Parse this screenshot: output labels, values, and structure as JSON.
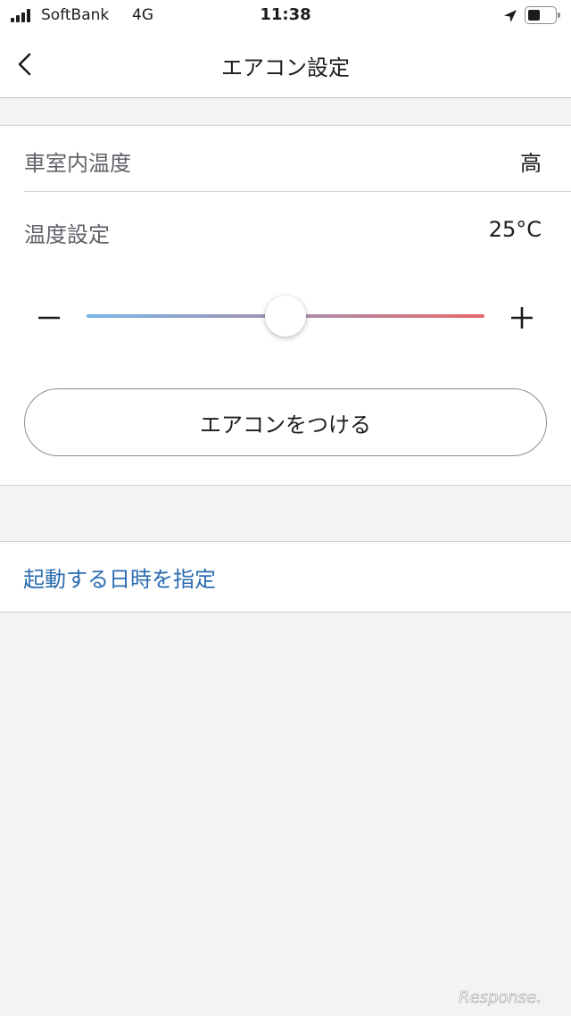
{
  "status_bar": {
    "carrier": "SoftBank",
    "network": "4G",
    "time": "11:38"
  },
  "nav": {
    "title": "エアコン設定"
  },
  "cabin_temp": {
    "label": "車室内温度",
    "value": "高"
  },
  "temp_setting": {
    "label": "温度設定",
    "value": "25°C"
  },
  "slider": {
    "level": 0.5,
    "gradient_start": "#7ab6e8",
    "gradient_end": "#e86a6a"
  },
  "ac_button": {
    "label": "エアコンをつける"
  },
  "schedule": {
    "label": "起動する日時を指定",
    "color": "#2b6cb0"
  },
  "watermark": {
    "text": "Response."
  }
}
